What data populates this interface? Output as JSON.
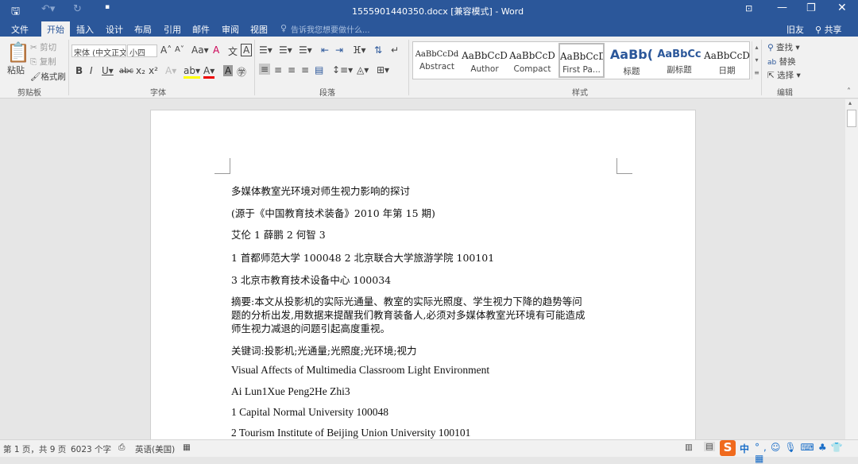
{
  "window": {
    "title": "1555901440350.docx [兼容模式] - Word"
  },
  "tabs": [
    {
      "label": "文件"
    },
    {
      "label": "开始"
    },
    {
      "label": "插入"
    },
    {
      "label": "设计"
    },
    {
      "label": "布局"
    },
    {
      "label": "引用"
    },
    {
      "label": "邮件"
    },
    {
      "label": "审阅"
    },
    {
      "label": "视图"
    }
  ],
  "tell_me": "告诉我您想要做什么...",
  "user": "旧友",
  "share": "共享",
  "clipboard": {
    "paste": "粘贴",
    "cut": "剪切",
    "copy": "复制",
    "format_painter": "格式刷",
    "label": "剪贴板"
  },
  "font": {
    "name": "宋体 (中文正文)",
    "size": "小四",
    "label": "字体"
  },
  "paragraph": {
    "label": "段落"
  },
  "styles": {
    "label": "样式",
    "items": [
      {
        "preview": "AaBbCcDd",
        "name": "Abstract"
      },
      {
        "preview": "AaBbCcD",
        "name": "Author"
      },
      {
        "preview": "AaBbCcD",
        "name": "Compact"
      },
      {
        "preview": "AaBbCcD",
        "name": "First Pa..."
      },
      {
        "preview": "AaBb(",
        "name": "标题"
      },
      {
        "preview": "AaBbCc",
        "name": "副标题"
      },
      {
        "preview": "AaBbCcD",
        "name": "日期"
      }
    ]
  },
  "editing": {
    "find": "查找",
    "replace": "替换",
    "select": "选择",
    "label": "编辑"
  },
  "document": {
    "lines": [
      "多媒体教室光环境对师生视力影响的探讨",
      "(源于《中国教育技术装备》2010 年第 15 期)",
      "艾伦 1 薛鹏 2 何智 3",
      "1 首都师范大学 100048 2 北京联合大学旅游学院 100101",
      "3 北京市教育技术设备中心 100034",
      "摘要:本文从投影机的实际光通量、教室的实际光照度、学生视力下降的趋势等问",
      "题的分析出发,用数据来提醒我们教育装备人,必须对多媒体教室光环境有可能造成",
      "师生视力减退的问题引起高度重视。",
      "关键词:投影机;光通量;光照度;光环境;视力",
      "Visual Affects of Multimedia Classroom Light Environment",
      "Ai Lun1Xue Peng2He Zhi3",
      "1 Capital Normal University 100048",
      "2 Tourism Institute of Beijing Union University 100101"
    ]
  },
  "status": {
    "page": "第 1 页，共 9 页",
    "words": "6023 个字",
    "language": "英语(美国)"
  },
  "ime": {
    "mode": "中"
  }
}
